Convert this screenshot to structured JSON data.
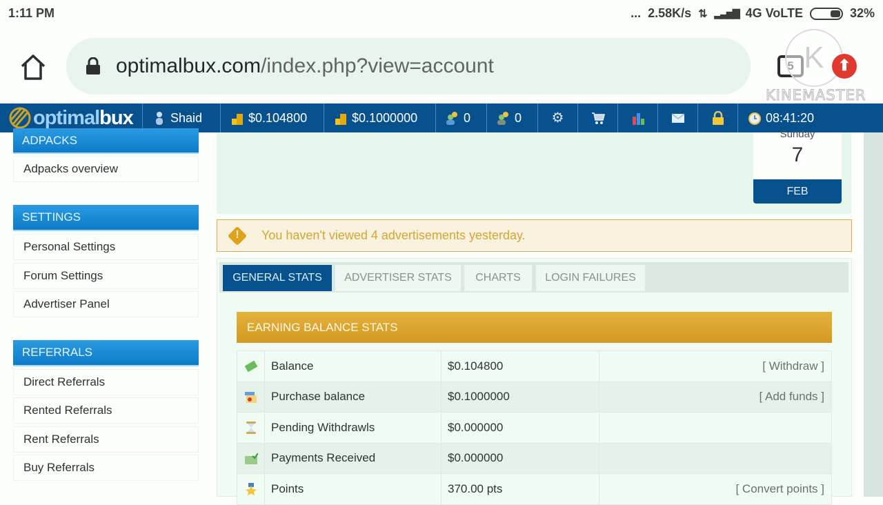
{
  "status_bar": {
    "time": "1:11 PM",
    "more": "...",
    "net_speed": "2.58K/s",
    "network": "4G VoLTE",
    "battery": "32%"
  },
  "browser": {
    "url_host": "optimalbux.com",
    "url_path": "/index.php?view=account",
    "tab_count": "5",
    "overlay_watermark": "KINEMASTER",
    "overlay_logo_letter": "K"
  },
  "topnav": {
    "logo_a": "opti",
    "logo_b": "mal",
    "logo_c": "bux",
    "username": "Shaid",
    "balance": "$0.104800",
    "purchase_balance": "$0.1000000",
    "direct_refs": "0",
    "rented_refs": "0",
    "clock": "08:41:20"
  },
  "sidebar": {
    "sections": [
      {
        "title": "ADPACKS",
        "items": [
          "Adpacks overview"
        ]
      },
      {
        "title": "SETTINGS",
        "items": [
          "Personal Settings",
          "Forum Settings",
          "Advertiser Panel"
        ]
      },
      {
        "title": "REFERRALS",
        "items": [
          "Direct Referrals",
          "Rented Referrals",
          "Rent Referrals",
          "Buy Referrals"
        ]
      }
    ]
  },
  "calendar": {
    "weekday": "Sunday",
    "day": "7",
    "month": "FEB"
  },
  "alert": {
    "message": "You haven't viewed 4 advertisements yesterday."
  },
  "tabs": [
    {
      "label": "GENERAL STATS",
      "active": true
    },
    {
      "label": "ADVERTISER STATS",
      "active": false
    },
    {
      "label": "CHARTS",
      "active": false
    },
    {
      "label": "LOGIN FAILURES",
      "active": false
    }
  ],
  "earning_stats": {
    "title": "EARNING BALANCE STATS",
    "rows": [
      {
        "icon": "money-icon",
        "label": "Balance",
        "value": "$0.104800",
        "action": "[ Withdraw ]"
      },
      {
        "icon": "purchase-icon",
        "label": "Purchase balance",
        "value": "$0.1000000",
        "action": "[ Add funds ]"
      },
      {
        "icon": "hourglass-icon",
        "label": "Pending Withdrawls",
        "value": "$0.000000",
        "action": ""
      },
      {
        "icon": "payment-received-icon",
        "label": "Payments Received",
        "value": "$0.000000",
        "action": ""
      },
      {
        "icon": "medal-icon",
        "label": "Points",
        "value": "370.00 pts",
        "action": "[ Convert points ]"
      }
    ]
  }
}
